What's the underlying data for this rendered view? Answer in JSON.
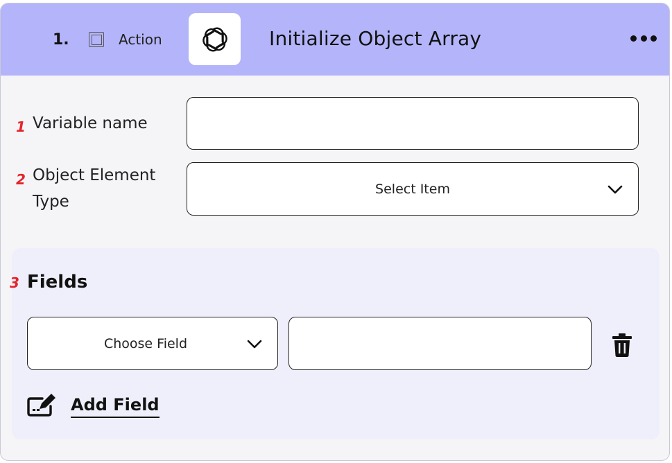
{
  "header": {
    "step_number": "1.",
    "action_label": "Action",
    "title": "Initialize Object Array",
    "app_icon": "openai-logo-icon",
    "more_icon": "more-horizontal-icon",
    "checkbox_icon": "checkbox-icon"
  },
  "form": {
    "variable_name": {
      "marker": "1",
      "label": "Variable name",
      "value": "",
      "placeholder": ""
    },
    "object_element_type": {
      "marker": "2",
      "label_line1": "Object Element",
      "label_line2": "Type",
      "selected": "Select Item"
    }
  },
  "fields_section": {
    "marker": "3",
    "heading": "Fields",
    "rows": [
      {
        "field_select": "Choose Field",
        "value": ""
      }
    ],
    "add_field_label": "Add Field",
    "add_icon": "edit-icon",
    "delete_icon": "trash-icon"
  },
  "colors": {
    "header_bg": "#b4b4fa",
    "card_bg": "#f5f5f8",
    "panel_bg": "#efeffb",
    "marker": "#e3242b"
  }
}
